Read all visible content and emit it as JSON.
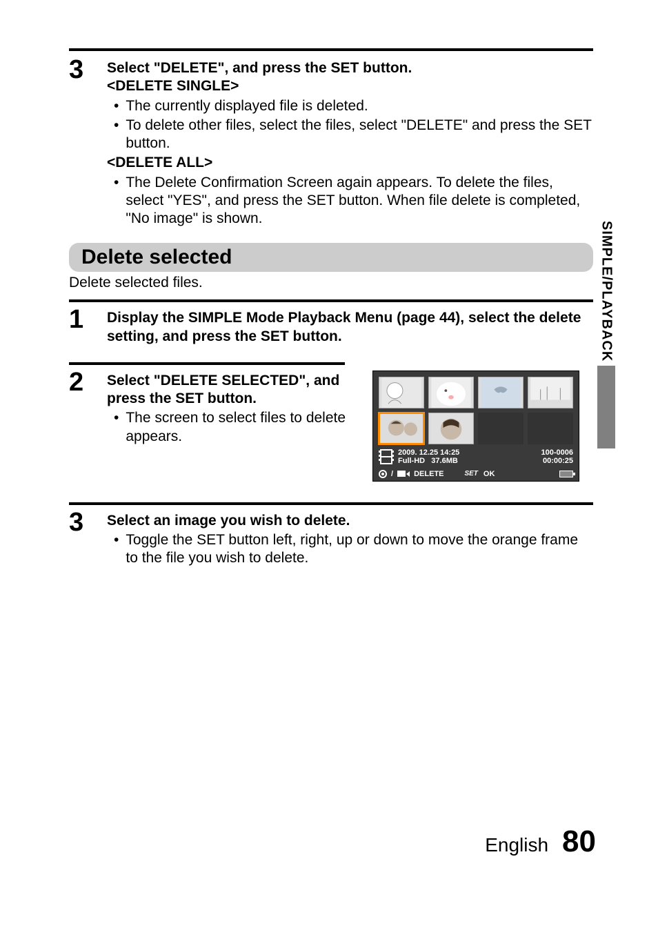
{
  "side_tab": "SIMPLE/PLAYBACK",
  "step3a": {
    "num": "3",
    "title": "Select \"DELETE\", and press the SET button.",
    "sub1": "<DELETE SINGLE>",
    "bullets1": [
      "The currently displayed file is deleted.",
      "To delete other files, select the files, select \"DELETE\" and press the SET button."
    ],
    "sub2": "<DELETE ALL>",
    "bullets2": [
      "The Delete Confirmation Screen again appears. To delete the files, select \"YES\", and press the SET button. When file delete is completed, \"No image\" is shown."
    ]
  },
  "section": {
    "heading": "Delete selected",
    "sub": "Delete selected files."
  },
  "step1": {
    "num": "1",
    "title": "Display the SIMPLE Mode Playback Menu (page 44), select the delete setting, and press the SET button."
  },
  "step2": {
    "num": "2",
    "title": "Select \"DELETE SELECTED\", and press the SET button.",
    "bullets": [
      "The screen to select files to delete appears."
    ]
  },
  "camera": {
    "datetime": "2009. 12.25  14:25",
    "quality": "Full-HD",
    "size": "37.6MB",
    "file_no": "100-0006",
    "duration": "00:00:25",
    "delete_label": "DELETE",
    "set_label": "SET",
    "ok_label": "OK",
    "slash": "/"
  },
  "step3b": {
    "num": "3",
    "title": "Select an image you wish to delete.",
    "bullets": [
      "Toggle the SET button left, right, up or down to move the orange frame to the file you wish to delete."
    ]
  },
  "footer": {
    "lang": "English",
    "page": "80"
  }
}
